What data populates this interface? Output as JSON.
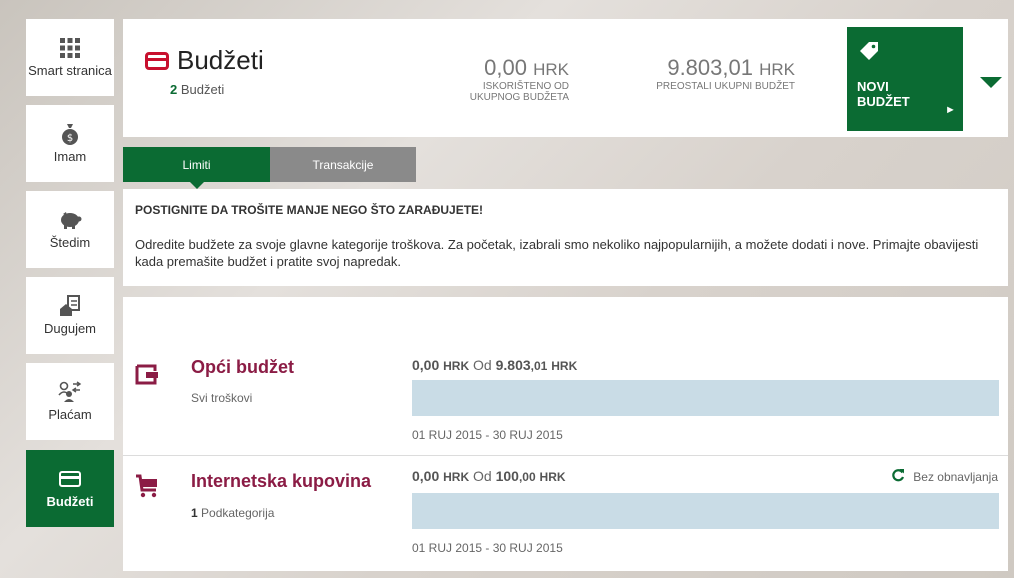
{
  "sidebar": {
    "items": [
      {
        "label": "Smart stranica",
        "icon": "grid-icon"
      },
      {
        "label": "Imam",
        "icon": "money-bag-icon"
      },
      {
        "label": "Štedim",
        "icon": "piggy-bank-icon"
      },
      {
        "label": "Dugujem",
        "icon": "house-document-icon"
      },
      {
        "label": "Plaćam",
        "icon": "payment-people-icon"
      },
      {
        "label": "Budžeti",
        "icon": "card-icon",
        "active": true
      }
    ]
  },
  "header": {
    "title": "Budžeti",
    "count": "2",
    "count_label": "Budžeti",
    "used_amount": "0,00",
    "used_currency": "HRK",
    "used_label": "ISKORIŠTENO OD UKUPNOG BUDŽETA",
    "remaining_amount": "9.803,01",
    "remaining_currency": "HRK",
    "remaining_label": "PREOSTALI UKUPNI BUDŽET",
    "new_button_line1": "NOVI",
    "new_button_line2": "BUDŽET"
  },
  "tabs": [
    {
      "label": "Limiti",
      "active": true
    },
    {
      "label": "Transakcije",
      "active": false
    }
  ],
  "info": {
    "heading": "POSTIGNITE DA TROŠITE MANJE NEGO ŠTO ZARAĐUJETE!",
    "body": "Odredite budžete za svoje glavne kategorije troškova. Za početak, izabrali smo nekoliko najpopularnijih, a možete dodati i nove. Primajte obavijesti kada premašite budžet i pratite svoj napredak."
  },
  "budgets": [
    {
      "name": "Opći budžet",
      "sub_count": "",
      "sub_label": "Svi troškovi",
      "spent": "0,00",
      "currency": "HRK",
      "of_word": "Od",
      "limit_whole": "9.803",
      "limit_dec": ",01",
      "progress": 0,
      "dates": "01 RUJ 2015 - 30 RUJ 2015",
      "renew": ""
    },
    {
      "name": "Internetska kupovina",
      "sub_count": "1",
      "sub_label": "Podkategorija",
      "spent": "0,00",
      "currency": "HRK",
      "of_word": "Od",
      "limit_whole": "100",
      "limit_dec": ",00",
      "progress": 0,
      "dates": "01 RUJ 2015 - 30 RUJ 2015",
      "renew": "Bez obnavljanja"
    }
  ],
  "colors": {
    "brand_green": "#0b6b33",
    "budget_red": "#8b1c45",
    "bar": "#c9dce6",
    "tab_grey": "#8a8a8a"
  }
}
